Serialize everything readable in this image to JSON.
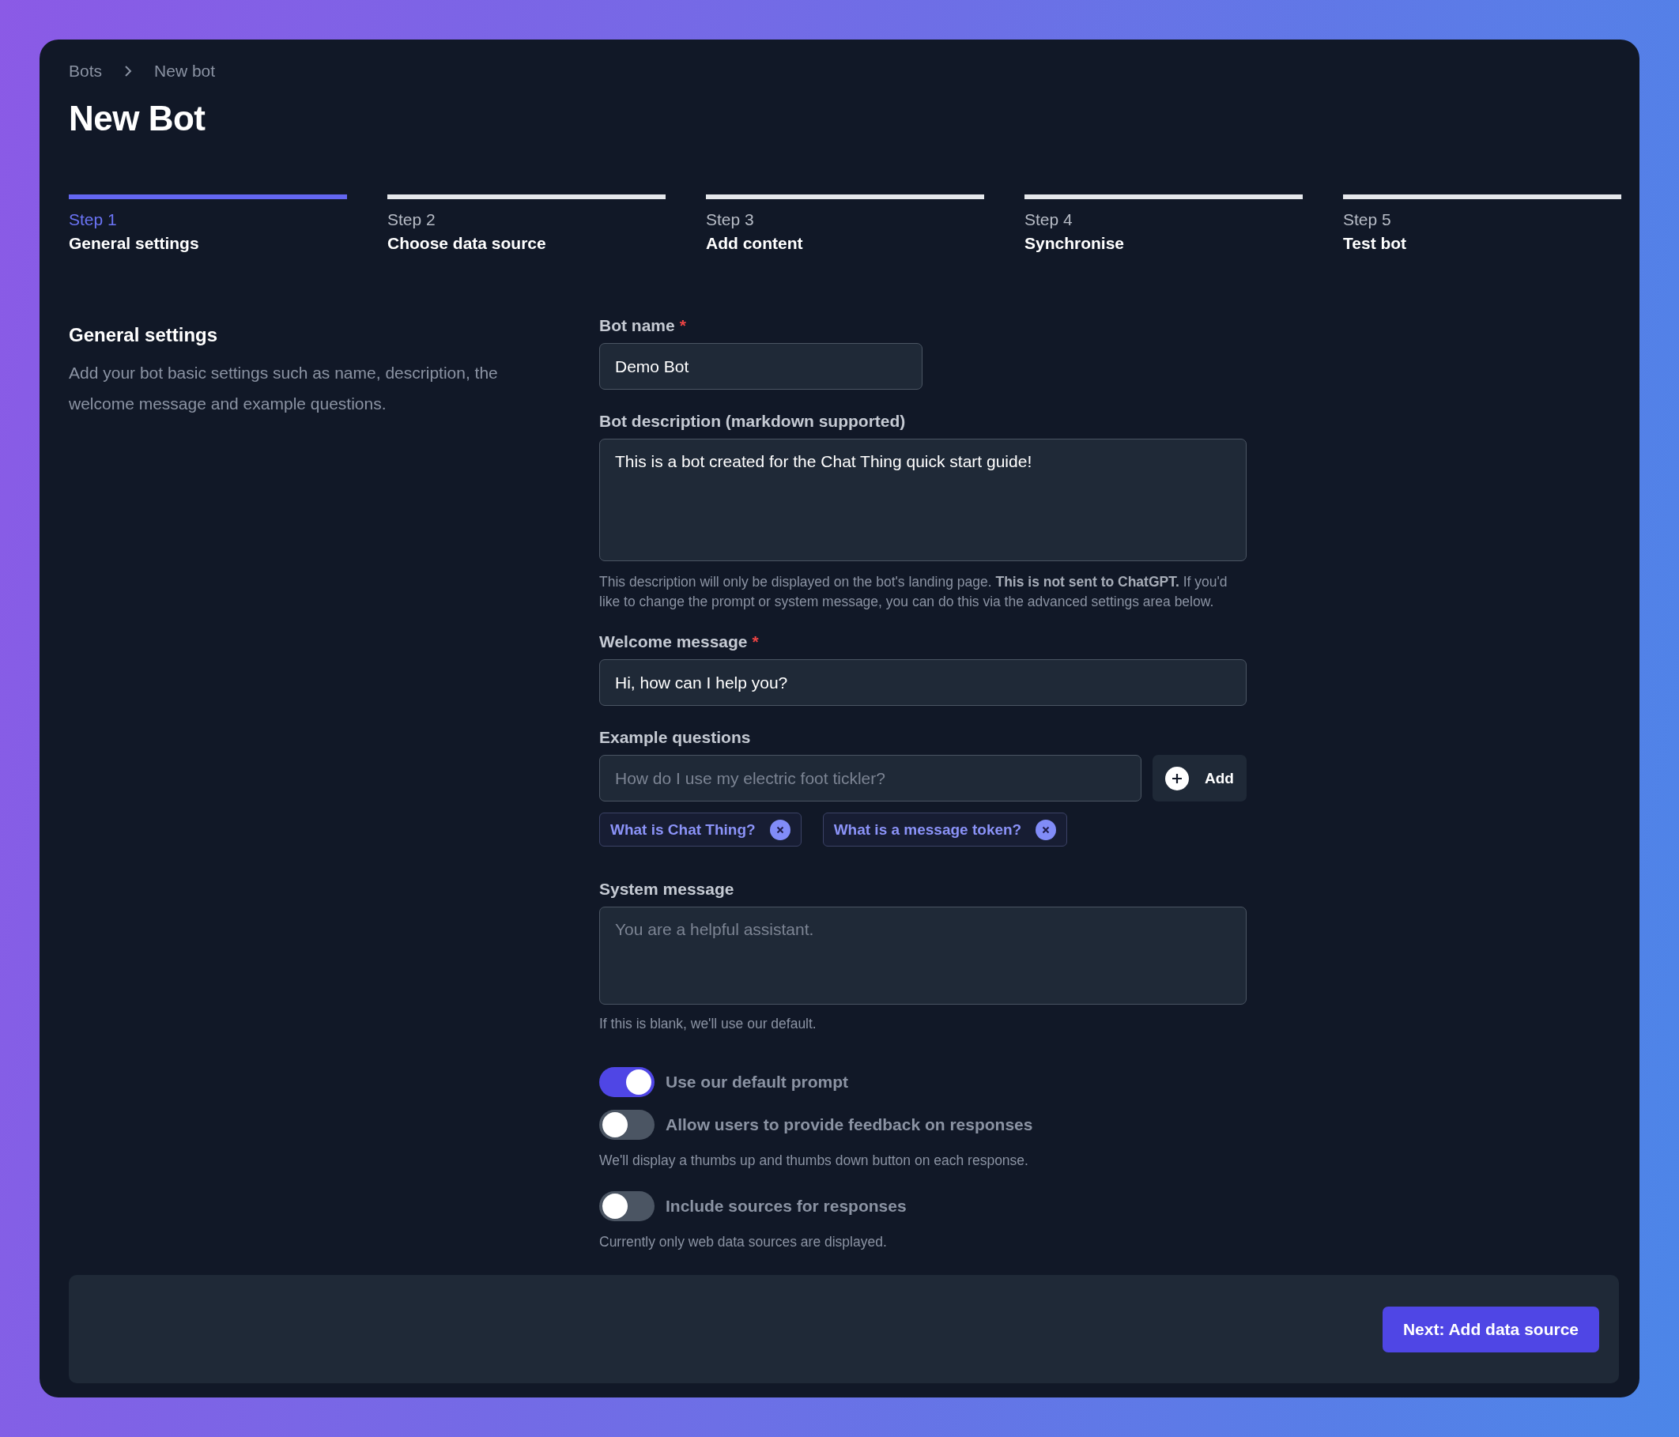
{
  "breadcrumb": [
    "Bots",
    "New bot"
  ],
  "title": "New Bot",
  "steps": [
    {
      "step": "Step 1",
      "name": "General settings",
      "selected": true
    },
    {
      "step": "Step 2",
      "name": "Choose data source",
      "selected": false
    },
    {
      "step": "Step 3",
      "name": "Add content",
      "selected": false
    },
    {
      "step": "Step 4",
      "name": "Synchronise",
      "selected": false
    },
    {
      "step": "Step 5",
      "name": "Test bot",
      "selected": false
    }
  ],
  "section": {
    "title": "General settings",
    "description": "Add your bot basic settings such as name, description, the welcome message and example questions."
  },
  "bot_name": {
    "label": "Bot name",
    "required_mark": "*",
    "value": "Demo Bot"
  },
  "bot_description": {
    "label": "Bot description (markdown supported)",
    "value": "This is a bot created for the Chat Thing quick start guide!",
    "help": "This description will only be displayed on the bot's landing page. **This is not sent to ChatGPT.** If you'd like to change the prompt or system message, you can do this via the advanced settings area below."
  },
  "welcome_message": {
    "label": "Welcome message",
    "required_mark": "*",
    "value": "Hi, how can I help you?"
  },
  "example_questions": {
    "label": "Example questions",
    "placeholder": "How do I use my electric foot tickler?",
    "add_button": "Add",
    "chips": [
      "What is Chat Thing?",
      "What is a message token?"
    ]
  },
  "system_message": {
    "label": "System message",
    "placeholder": "You are a helpful assistant.",
    "help": "If this is blank, we'll use our default."
  },
  "toggles": [
    {
      "label": "Use our default prompt",
      "on": true
    },
    {
      "label": "Allow users to provide feedback on responses",
      "on": false,
      "help": "We'll display a thumbs up and thumbs down button on each response."
    },
    {
      "label": "Include sources for responses",
      "on": false,
      "help": "Currently only web data sources are displayed."
    }
  ],
  "next_button": "Next: Add data source"
}
